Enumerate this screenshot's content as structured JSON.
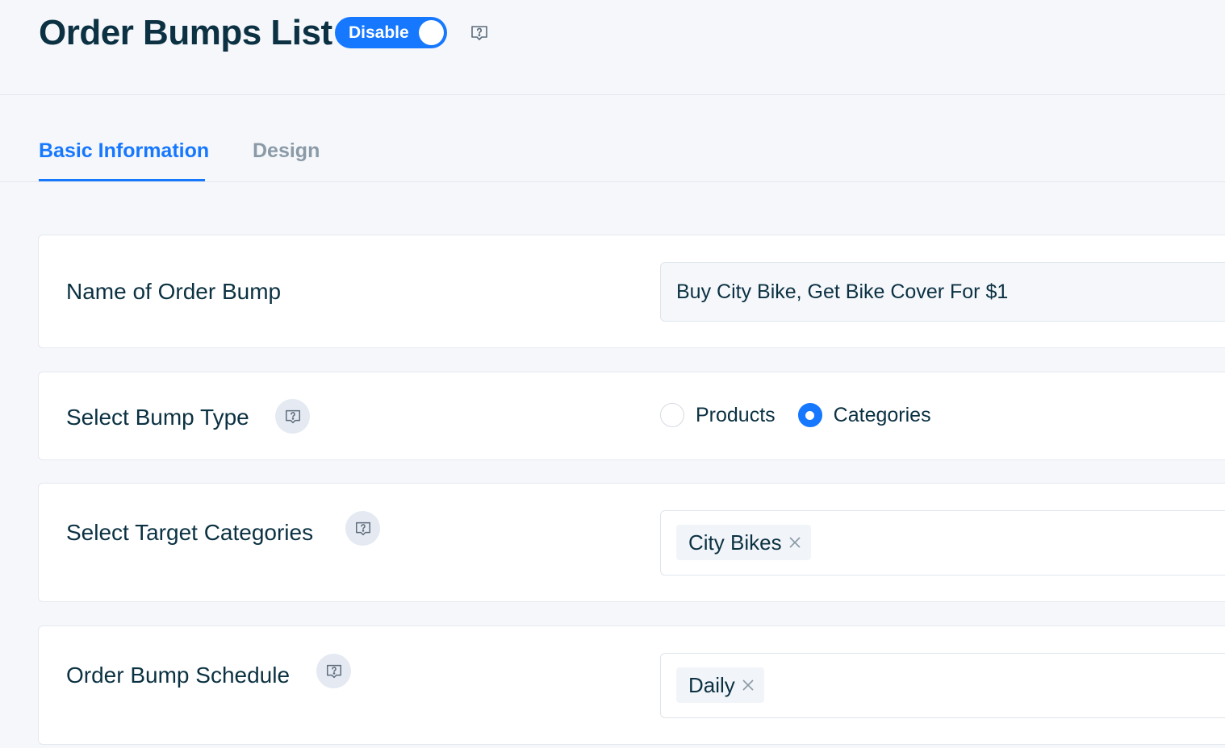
{
  "header": {
    "title": "Order Bumps List",
    "toggle_label": "Disable"
  },
  "tabs": [
    {
      "label": "Basic Information",
      "active": true
    },
    {
      "label": "Design",
      "active": false
    }
  ],
  "form": {
    "name": {
      "label": "Name of Order Bump",
      "value": "Buy City Bike, Get Bike Cover For $1"
    },
    "bump_type": {
      "label": "Select Bump Type",
      "options": [
        {
          "label": "Products",
          "checked": false
        },
        {
          "label": "Categories",
          "checked": true
        }
      ]
    },
    "target_categories": {
      "label": "Select Target Categories",
      "tags": [
        "City Bikes"
      ]
    },
    "schedule": {
      "label": "Order Bump Schedule",
      "tags": [
        "Daily"
      ]
    }
  },
  "colors": {
    "accent": "#1677ff",
    "text": "#0b3142",
    "muted": "#8a9aa6",
    "background": "#f5f7fb"
  }
}
